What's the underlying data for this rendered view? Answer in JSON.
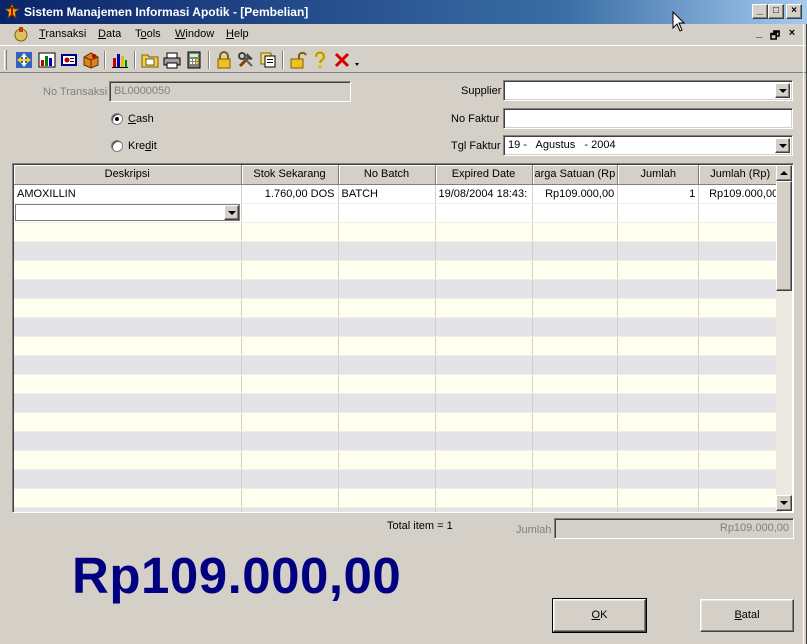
{
  "window": {
    "title": "Sistem Manajemen Informasi Apotik - [Pembelian]",
    "buttons": {
      "minimize": "_",
      "maximize": "□",
      "close": "×"
    },
    "mdi_controls": {
      "minimize": "_",
      "restore": "🗗",
      "close": "×"
    }
  },
  "menu": {
    "items": [
      {
        "pre": "",
        "key": "T",
        "post": "ransaksi"
      },
      {
        "pre": "",
        "key": "D",
        "post": "ata"
      },
      {
        "pre": "T",
        "key": "o",
        "post": "ols"
      },
      {
        "pre": "",
        "key": "W",
        "post": "indow"
      },
      {
        "pre": "",
        "key": "H",
        "post": "elp"
      }
    ]
  },
  "toolbar": {
    "icons": [
      "move-icon",
      "chart-icon",
      "report-icon",
      "package-icon",
      "bar-chart-icon",
      "folder-icon",
      "printer-icon",
      "calculator-icon",
      "lock-icon",
      "tools-icon",
      "copy-icon",
      "open-lock-icon",
      "help-icon",
      "delete-icon",
      "dropdown-arrow-icon"
    ]
  },
  "form": {
    "no_transaksi_label": "No Transaksi",
    "no_transaksi_value": "BL0000050",
    "payment": {
      "cash": {
        "pre": "",
        "key": "C",
        "post": "ash",
        "checked": true
      },
      "kredit": {
        "pre": "Kre",
        "key": "d",
        "post": "it",
        "checked": false
      }
    },
    "supplier_label": "Supplier",
    "supplier_value": "",
    "no_faktur_label": "No Faktur",
    "no_faktur_value": "",
    "tgl_faktur_label": "Tgl Faktur",
    "tgl_faktur_value": "19 -   Agustus   - 2004"
  },
  "grid": {
    "columns": [
      "Deskripsi",
      "Stok Sekarang",
      "No Batch",
      "Expired Date",
      "arga Satuan (Rp",
      "Jumlah",
      "Jumlah (Rp)"
    ],
    "rows": [
      [
        "AMOXILLIN",
        "1.760,00 DOS",
        "BATCH",
        "19/08/2004 18:43:",
        "Rp109.000,00",
        "1",
        "Rp109.000,00"
      ]
    ],
    "empty_rows": 16
  },
  "summary": {
    "total_item": "Total item = 1",
    "jumlah_label": "Jumlah",
    "jumlah_value": "Rp109.000,00",
    "big_total": "Rp109.000,00"
  },
  "buttons": {
    "ok": {
      "pre": "",
      "key": "O",
      "post": "K"
    },
    "batal": {
      "pre": "",
      "key": "B",
      "post": "atal"
    }
  }
}
